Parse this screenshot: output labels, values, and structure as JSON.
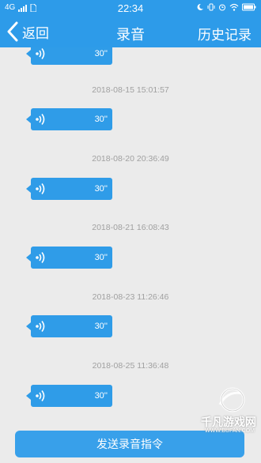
{
  "status_bar": {
    "network": "4G",
    "time": "22:34"
  },
  "nav": {
    "back_label": "返回",
    "title": "录音",
    "history_label": "历史记录"
  },
  "records": [
    {
      "timestamp": "",
      "duration": "30''"
    },
    {
      "timestamp": "2018-08-15 15:01:57",
      "duration": "30''"
    },
    {
      "timestamp": "2018-08-20 20:36:49",
      "duration": "30''"
    },
    {
      "timestamp": "2018-08-21 16:08:43",
      "duration": "30''"
    },
    {
      "timestamp": "2018-08-23 11:26:46",
      "duration": "30''"
    },
    {
      "timestamp": "2018-08-25 11:36:48",
      "duration": "30''"
    }
  ],
  "send_button_label": "发送录音指令",
  "watermark": {
    "name": "千凡游戏网",
    "url": "WWW.BUFAN.COM"
  },
  "colors": {
    "accent": "#2d9be9",
    "bubble": "#2f9ce8",
    "background": "#ebebeb",
    "timestamp_text": "#a0a0a0"
  },
  "icons": [
    "back-chevron-icon",
    "sound-wave-icon",
    "battery-icon",
    "wifi-icon",
    "signal-icon"
  ]
}
